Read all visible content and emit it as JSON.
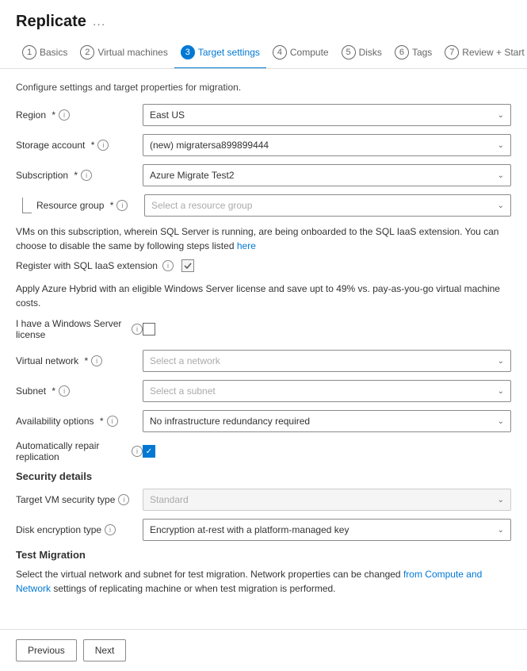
{
  "page": {
    "title": "Replicate",
    "dots": "..."
  },
  "wizard": {
    "steps": [
      {
        "num": "1",
        "label": "Basics",
        "active": false
      },
      {
        "num": "2",
        "label": "Virtual machines",
        "active": false
      },
      {
        "num": "3",
        "label": "Target settings",
        "active": true
      },
      {
        "num": "4",
        "label": "Compute",
        "active": false
      },
      {
        "num": "5",
        "label": "Disks",
        "active": false
      },
      {
        "num": "6",
        "label": "Tags",
        "active": false
      },
      {
        "num": "7",
        "label": "Review + Start replication",
        "active": false
      }
    ]
  },
  "content": {
    "section_desc": "Configure settings and target properties for migration.",
    "region_label": "Region",
    "region_value": "East US",
    "storage_account_label": "Storage account",
    "storage_account_value": "(new) migratersa899899444",
    "subscription_label": "Subscription",
    "subscription_value": "Azure Migrate Test2",
    "resource_group_label": "Resource group",
    "resource_group_placeholder": "Select a resource group",
    "sql_info": "VMs on this subscription, wherein SQL Server is running, are being onboarded to the SQL IaaS extension. You can choose to disable the same by following steps listed",
    "sql_link": "here",
    "register_sql_label": "Register with SQL IaaS extension",
    "apply_azure_text": "Apply Azure Hybrid with an eligible Windows Server license and save upt to 49% vs. pay-as-you-go virtual machine costs.",
    "windows_license_label": "I have a Windows Server license",
    "virtual_network_label": "Virtual network",
    "virtual_network_placeholder": "Select a network",
    "subnet_label": "Subnet",
    "subnet_placeholder": "Select a subnet",
    "availability_label": "Availability options",
    "availability_value": "No infrastructure redundancy required",
    "auto_repair_label": "Automatically repair replication",
    "security_title": "Security details",
    "target_vm_security_label": "Target VM security type",
    "target_vm_security_value": "Standard",
    "disk_encryption_label": "Disk encryption type",
    "disk_encryption_value": "Encryption at-rest with a platform-managed key",
    "test_migration_title": "Test Migration",
    "test_migration_desc": "Select the virtual network and subnet for test migration. Network properties can be changed from Compute and Network settings of replicating machine or when test migration is performed.",
    "from_link": "from",
    "compute_network_link": "Compute and Network",
    "buttons": {
      "previous": "Previous",
      "next": "Next"
    }
  }
}
